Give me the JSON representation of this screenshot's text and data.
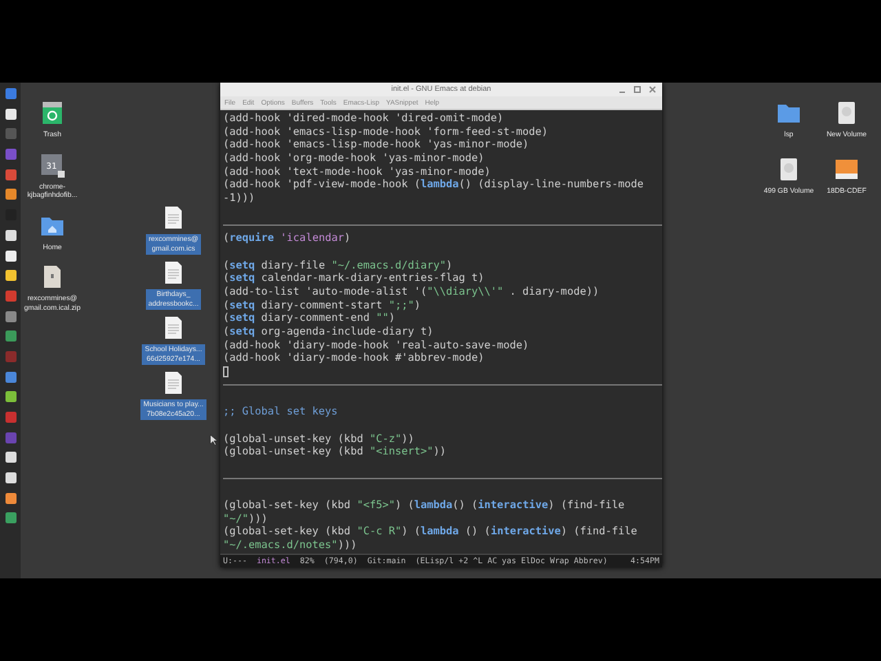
{
  "window": {
    "title": "init.el - GNU Emacs at debian",
    "menu": [
      "File",
      "Edit",
      "Options",
      "Buffers",
      "Tools",
      "Emacs-Lisp",
      "YASnippet",
      "Help"
    ]
  },
  "editor": {
    "lines": [
      {
        "kind": "code",
        "segments": [
          {
            "text": "(add-hook 'dired-mode-hook 'dired-omit-mode)",
            "kind": "plain"
          }
        ]
      },
      {
        "kind": "code",
        "segments": [
          {
            "text": "(add-hook 'emacs-lisp-mode-hook 'form-feed-st-mode)",
            "kind": "plain"
          }
        ]
      },
      {
        "kind": "code",
        "segments": [
          {
            "text": "(add-hook 'emacs-lisp-mode-hook 'yas-minor-mode)",
            "kind": "plain"
          }
        ]
      },
      {
        "kind": "code",
        "segments": [
          {
            "text": "(add-hook 'org-mode-hook 'yas-minor-mode)",
            "kind": "plain"
          }
        ]
      },
      {
        "kind": "code",
        "segments": [
          {
            "text": "(add-hook 'text-mode-hook 'yas-minor-mode)",
            "kind": "plain"
          }
        ]
      },
      {
        "kind": "code",
        "segments": [
          {
            "text": "(add-hook 'pdf-view-mode-hook (",
            "kind": "plain"
          },
          {
            "text": "lambda",
            "kind": "keyword"
          },
          {
            "text": "() (display-line-numbers-mode",
            "kind": "plain"
          }
        ]
      },
      {
        "kind": "code",
        "segments": [
          {
            "text": "-1)))",
            "kind": "plain"
          }
        ]
      },
      {
        "kind": "blank"
      },
      {
        "kind": "rule"
      },
      {
        "kind": "code",
        "segments": [
          {
            "text": "(",
            "kind": "plain"
          },
          {
            "text": "require",
            "kind": "keyword"
          },
          {
            "text": " 'icalendar",
            "kind": "constant"
          },
          {
            "text": ")",
            "kind": "plain"
          }
        ]
      },
      {
        "kind": "blank"
      },
      {
        "kind": "code",
        "segments": [
          {
            "text": "(",
            "kind": "plain"
          },
          {
            "text": "setq",
            "kind": "keyword"
          },
          {
            "text": " diary-file ",
            "kind": "plain"
          },
          {
            "text": "\"~/.emacs.d/diary\"",
            "kind": "string"
          },
          {
            "text": ")",
            "kind": "plain"
          }
        ]
      },
      {
        "kind": "code",
        "segments": [
          {
            "text": "(",
            "kind": "plain"
          },
          {
            "text": "setq",
            "kind": "keyword"
          },
          {
            "text": " calendar-mark-diary-entries-flag t)",
            "kind": "plain"
          }
        ]
      },
      {
        "kind": "code",
        "segments": [
          {
            "text": "(add-to-list 'auto-mode-alist '(",
            "kind": "plain"
          },
          {
            "text": "\"\\\\diary\\\\'\"",
            "kind": "string"
          },
          {
            "text": " . diary-mode))",
            "kind": "plain"
          }
        ]
      },
      {
        "kind": "code",
        "segments": [
          {
            "text": "(",
            "kind": "plain"
          },
          {
            "text": "setq",
            "kind": "keyword"
          },
          {
            "text": " diary-comment-start ",
            "kind": "plain"
          },
          {
            "text": "\";;\"",
            "kind": "string"
          },
          {
            "text": ")",
            "kind": "plain"
          }
        ]
      },
      {
        "kind": "code",
        "segments": [
          {
            "text": "(",
            "kind": "plain"
          },
          {
            "text": "setq",
            "kind": "keyword"
          },
          {
            "text": " diary-comment-end ",
            "kind": "plain"
          },
          {
            "text": "\"\"",
            "kind": "string"
          },
          {
            "text": ")",
            "kind": "plain"
          }
        ]
      },
      {
        "kind": "code",
        "segments": [
          {
            "text": "(",
            "kind": "plain"
          },
          {
            "text": "setq",
            "kind": "keyword"
          },
          {
            "text": " org-agenda-include-diary t)",
            "kind": "plain"
          }
        ]
      },
      {
        "kind": "code",
        "segments": [
          {
            "text": "(add-hook 'diary-mode-hook 'real-auto-save-mode)",
            "kind": "plain"
          }
        ]
      },
      {
        "kind": "code",
        "segments": [
          {
            "text": "(add-hook 'diary-mode-hook #'abbrev-mode)",
            "kind": "plain"
          }
        ]
      },
      {
        "kind": "cursor"
      },
      {
        "kind": "rule"
      },
      {
        "kind": "blank"
      },
      {
        "kind": "code",
        "segments": [
          {
            "text": ";; Global set keys",
            "kind": "comment"
          }
        ]
      },
      {
        "kind": "blank"
      },
      {
        "kind": "code",
        "segments": [
          {
            "text": "(global-unset-key (kbd ",
            "kind": "plain"
          },
          {
            "text": "\"C-z\"",
            "kind": "string"
          },
          {
            "text": "))",
            "kind": "plain"
          }
        ]
      },
      {
        "kind": "code",
        "segments": [
          {
            "text": "(global-unset-key (kbd ",
            "kind": "plain"
          },
          {
            "text": "\"<insert>\"",
            "kind": "string"
          },
          {
            "text": "))",
            "kind": "plain"
          }
        ]
      },
      {
        "kind": "blank"
      },
      {
        "kind": "rule"
      },
      {
        "kind": "blank"
      },
      {
        "kind": "code",
        "segments": [
          {
            "text": "(global-set-key (kbd ",
            "kind": "plain"
          },
          {
            "text": "\"<f5>\"",
            "kind": "string"
          },
          {
            "text": ") (",
            "kind": "plain"
          },
          {
            "text": "lambda",
            "kind": "keyword"
          },
          {
            "text": "() (",
            "kind": "plain"
          },
          {
            "text": "interactive",
            "kind": "keyword"
          },
          {
            "text": ") (find-file",
            "kind": "plain"
          }
        ]
      },
      {
        "kind": "code",
        "segments": [
          {
            "text": "\"~/\"",
            "kind": "string"
          },
          {
            "text": ")))",
            "kind": "plain"
          }
        ]
      },
      {
        "kind": "code",
        "segments": [
          {
            "text": "(global-set-key (kbd ",
            "kind": "plain"
          },
          {
            "text": "\"C-c R\"",
            "kind": "string"
          },
          {
            "text": ") (",
            "kind": "plain"
          },
          {
            "text": "lambda",
            "kind": "keyword"
          },
          {
            "text": " () (",
            "kind": "plain"
          },
          {
            "text": "interactive",
            "kind": "keyword"
          },
          {
            "text": ") (find-file",
            "kind": "plain"
          }
        ]
      },
      {
        "kind": "code",
        "segments": [
          {
            "text": "\"~/.emacs.d/notes\"",
            "kind": "string"
          },
          {
            "text": ")))",
            "kind": "plain"
          }
        ]
      }
    ]
  },
  "mode_line": [
    {
      "text": "U:---",
      "kind": "plain"
    },
    {
      "text": "init.el",
      "kind": "buffer"
    },
    {
      "text": "82%",
      "kind": "plain"
    },
    {
      "text": "(794,0)",
      "kind": "plain"
    },
    {
      "text": "Git:main",
      "kind": "plain"
    },
    {
      "text": "(ELisp/l +2 ^L AC yas ElDoc Wrap Abbrev)",
      "kind": "plain"
    },
    {
      "text": "4:54PM",
      "kind": "plain"
    }
  ],
  "desktop": {
    "left_icons": [
      {
        "kind": "trash",
        "label": [
          "Trash"
        ],
        "selected": false
      },
      {
        "kind": "calendar",
        "icon_text": "31",
        "label": [
          "chrome-",
          "kjbagfinhdofib..."
        ],
        "selected": false
      },
      {
        "kind": "home",
        "label": [
          "Home"
        ],
        "selected": false
      },
      {
        "kind": "archive",
        "label": [
          "rexcommines@",
          "gmail.com.ical.zip"
        ],
        "selected": false
      }
    ],
    "file_column": [
      {
        "kind": "document",
        "label": [
          "rexcommines@",
          "gmail.com.ics"
        ],
        "selected": true
      },
      {
        "kind": "document",
        "label": [
          "Birthdays_",
          "addressbookc..."
        ],
        "selected": true
      },
      {
        "kind": "document",
        "label": [
          "School Holidays...",
          "66d25927e174..."
        ],
        "selected": true
      },
      {
        "kind": "document",
        "label": [
          "Musicians to play...",
          "7b08e2c45a20..."
        ],
        "selected": true
      }
    ],
    "right_icons": [
      {
        "kind": "folder",
        "label": [
          "lsp"
        ],
        "selected": false
      },
      {
        "kind": "drive",
        "label": [
          "New Volume"
        ],
        "selected": false
      },
      {
        "kind": "drive",
        "label": [
          "499 GB Volume"
        ],
        "selected": false
      },
      {
        "kind": "usb",
        "label": [
          "18DB-CDEF"
        ],
        "selected": false
      }
    ]
  }
}
